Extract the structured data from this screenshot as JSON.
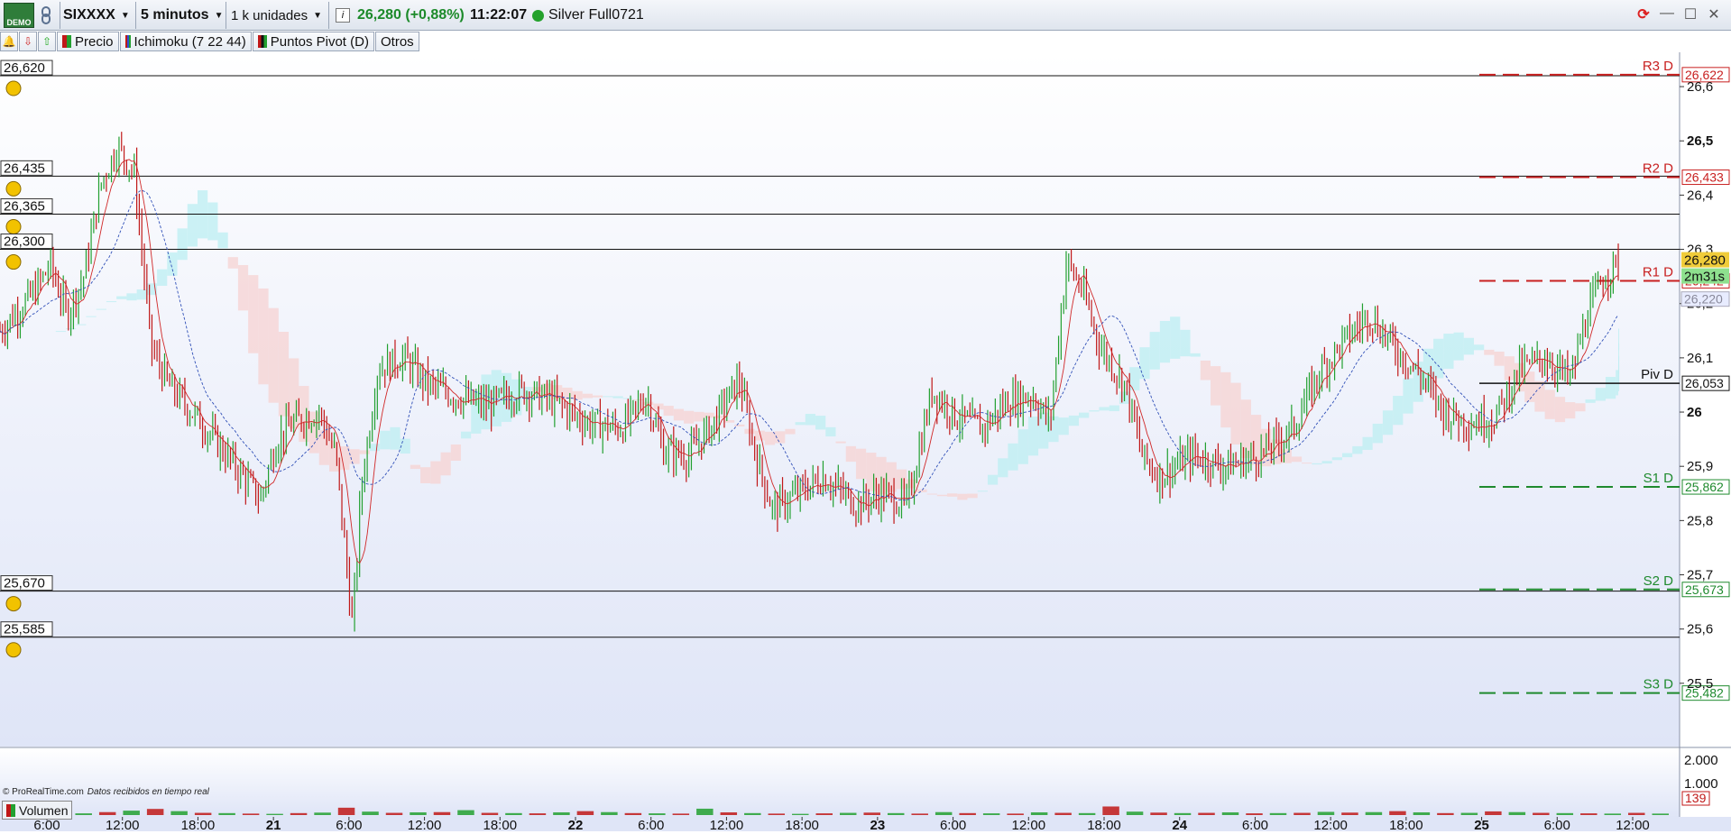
{
  "toolbar": {
    "demo_label": "DEMO",
    "symbol": "SIXXXX",
    "timeframe": "5 minutos",
    "units": "1 k unidades",
    "price": "26,280 (+0,88%)",
    "clock": "11:22:07",
    "account": "Silver Full0721",
    "icons": [
      "link-icon",
      "info-icon",
      "status-dot-icon",
      "refresh-icon",
      "restore-icon",
      "maximize-icon",
      "close-icon"
    ]
  },
  "indicators": {
    "precio": "Precio",
    "ichimoku": "Ichimoku (7 22 44)",
    "pivots": "Puntos Pivot (D)",
    "otros": "Otros"
  },
  "footer": {
    "copyright": "© ProRealTime.com",
    "realtime": "Datos recibidos en tiempo real"
  },
  "volume_panel": {
    "label": "Volumen",
    "axis_ticks": [
      "2.000",
      "1.000"
    ],
    "current": "139"
  },
  "chart_data": {
    "type": "candlestick",
    "axis": {
      "price_ticks": [
        26.6,
        26.5,
        26.4,
        26.3,
        26.2,
        26.1,
        26.0,
        25.9,
        25.8,
        25.7,
        25.6,
        25.5
      ],
      "price_tick_labels": [
        "26,6",
        "26,5",
        "26,4",
        "26,3",
        "26,2",
        "26,1",
        "26",
        "25,9",
        "25,8",
        "25,7",
        "25,6",
        "25,5"
      ],
      "bold_tick_labels": [
        "26,5",
        "26"
      ],
      "ylim": [
        25.4,
        26.65
      ],
      "time_labels": [
        "6:00",
        "12:00",
        "18:00",
        "21",
        "6:00",
        "12:00",
        "18:00",
        "22",
        "6:00",
        "12:00",
        "18:00",
        "23",
        "6:00",
        "12:00",
        "18:00",
        "24",
        "6:00",
        "12:00",
        "18:00",
        "25",
        "6:00",
        "12:00"
      ],
      "day_labels": [
        "21",
        "22",
        "23",
        "24",
        "25"
      ]
    },
    "price_alerts": [
      {
        "value": 26.62,
        "label": "26,620"
      },
      {
        "value": 26.435,
        "label": "26,435"
      },
      {
        "value": 26.365,
        "label": "26,365"
      },
      {
        "value": 26.3,
        "label": "26,300"
      },
      {
        "value": 25.67,
        "label": "25,670"
      },
      {
        "value": 25.585,
        "label": "25,585"
      }
    ],
    "pivots": [
      {
        "name": "R3 D",
        "value": 26.622,
        "label": "26,622",
        "color": "#c82020"
      },
      {
        "name": "R2 D",
        "value": 26.433,
        "label": "26,433",
        "color": "#c82020"
      },
      {
        "name": "R1 D",
        "value": 26.242,
        "label": "26,242",
        "color": "#c82020"
      },
      {
        "name": "Piv D",
        "value": 26.053,
        "label": "26,053",
        "color": "#111111"
      },
      {
        "name": "S1 D",
        "value": 25.862,
        "label": "25,862",
        "color": "#1f8a2e"
      },
      {
        "name": "S2 D",
        "value": 25.673,
        "label": "25,673",
        "color": "#1f8a2e"
      },
      {
        "name": "S3 D",
        "value": 25.482,
        "label": "25,482",
        "color": "#1f8a2e"
      }
    ],
    "last_price": {
      "value": 26.28,
      "label": "26,280"
    },
    "countdown": "2m31s",
    "ichimoku_value": {
      "value": 26.22,
      "label": "26,220"
    },
    "price_path": [
      [
        0,
        26.15
      ],
      [
        0.02,
        26.22
      ],
      [
        0.03,
        26.27
      ],
      [
        0.04,
        26.18
      ],
      [
        0.05,
        26.25
      ],
      [
        0.06,
        26.42
      ],
      [
        0.07,
        26.49
      ],
      [
        0.08,
        26.44
      ],
      [
        0.09,
        26.12
      ],
      [
        0.1,
        26.05
      ],
      [
        0.12,
        25.98
      ],
      [
        0.14,
        25.9
      ],
      [
        0.155,
        25.84
      ],
      [
        0.165,
        25.95
      ],
      [
        0.175,
        25.98
      ],
      [
        0.19,
        26.0
      ],
      [
        0.2,
        25.92
      ],
      [
        0.21,
        25.6
      ],
      [
        0.215,
        25.86
      ],
      [
        0.225,
        26.08
      ],
      [
        0.24,
        26.1
      ],
      [
        0.255,
        26.05
      ],
      [
        0.27,
        26.03
      ],
      [
        0.29,
        26.01
      ],
      [
        0.31,
        26.04
      ],
      [
        0.33,
        26.02
      ],
      [
        0.35,
        25.98
      ],
      [
        0.37,
        25.97
      ],
      [
        0.385,
        26.03
      ],
      [
        0.395,
        25.93
      ],
      [
        0.41,
        25.92
      ],
      [
        0.425,
        25.98
      ],
      [
        0.44,
        26.06
      ],
      [
        0.45,
        25.92
      ],
      [
        0.46,
        25.82
      ],
      [
        0.475,
        25.85
      ],
      [
        0.49,
        25.88
      ],
      [
        0.51,
        25.83
      ],
      [
        0.525,
        25.85
      ],
      [
        0.54,
        25.83
      ],
      [
        0.555,
        26.04
      ],
      [
        0.57,
        25.99
      ],
      [
        0.585,
        25.97
      ],
      [
        0.6,
        26.02
      ],
      [
        0.615,
        26.03
      ],
      [
        0.625,
        25.98
      ],
      [
        0.635,
        26.28
      ],
      [
        0.645,
        26.22
      ],
      [
        0.655,
        26.12
      ],
      [
        0.67,
        26.05
      ],
      [
        0.68,
        25.92
      ],
      [
        0.69,
        25.88
      ],
      [
        0.71,
        25.92
      ],
      [
        0.73,
        25.9
      ],
      [
        0.75,
        25.92
      ],
      [
        0.77,
        25.97
      ],
      [
        0.785,
        26.07
      ],
      [
        0.8,
        26.13
      ],
      [
        0.815,
        26.18
      ],
      [
        0.83,
        26.12
      ],
      [
        0.845,
        26.07
      ],
      [
        0.86,
        26.0
      ],
      [
        0.875,
        25.98
      ],
      [
        0.89,
        25.99
      ],
      [
        0.905,
        26.08
      ],
      [
        0.92,
        26.1
      ],
      [
        0.935,
        26.06
      ],
      [
        0.945,
        26.18
      ],
      [
        0.955,
        26.25
      ],
      [
        0.965,
        26.28
      ]
    ],
    "volume_bars": [
      40,
      60,
      90,
      70,
      120,
      180,
      250,
      160,
      90,
      80,
      60,
      50,
      80,
      100,
      300,
      140,
      90,
      110,
      120,
      200,
      90,
      80,
      70,
      110,
      160,
      120,
      80,
      70,
      60,
      260,
      110,
      80,
      60,
      50,
      70,
      90,
      100,
      80,
      60,
      120,
      80,
      70,
      60,
      110,
      90,
      80,
      350,
      140,
      100,
      80,
      90,
      110,
      70,
      80,
      90,
      130,
      100,
      120,
      160,
      110,
      80,
      90,
      150,
      120,
      90,
      80,
      70,
      60,
      90,
      60
    ]
  },
  "colors": {
    "bull": "#22a030",
    "bear": "#c01818",
    "last_price_bg": "#f0cc3a",
    "countdown_bg": "#8ee08e",
    "chart_bg_top": "#ffffff",
    "chart_bg_bottom": "#dfe5f7",
    "kumo_bull": "#bfeff2",
    "kumo_bear": "#f6d4d4"
  }
}
